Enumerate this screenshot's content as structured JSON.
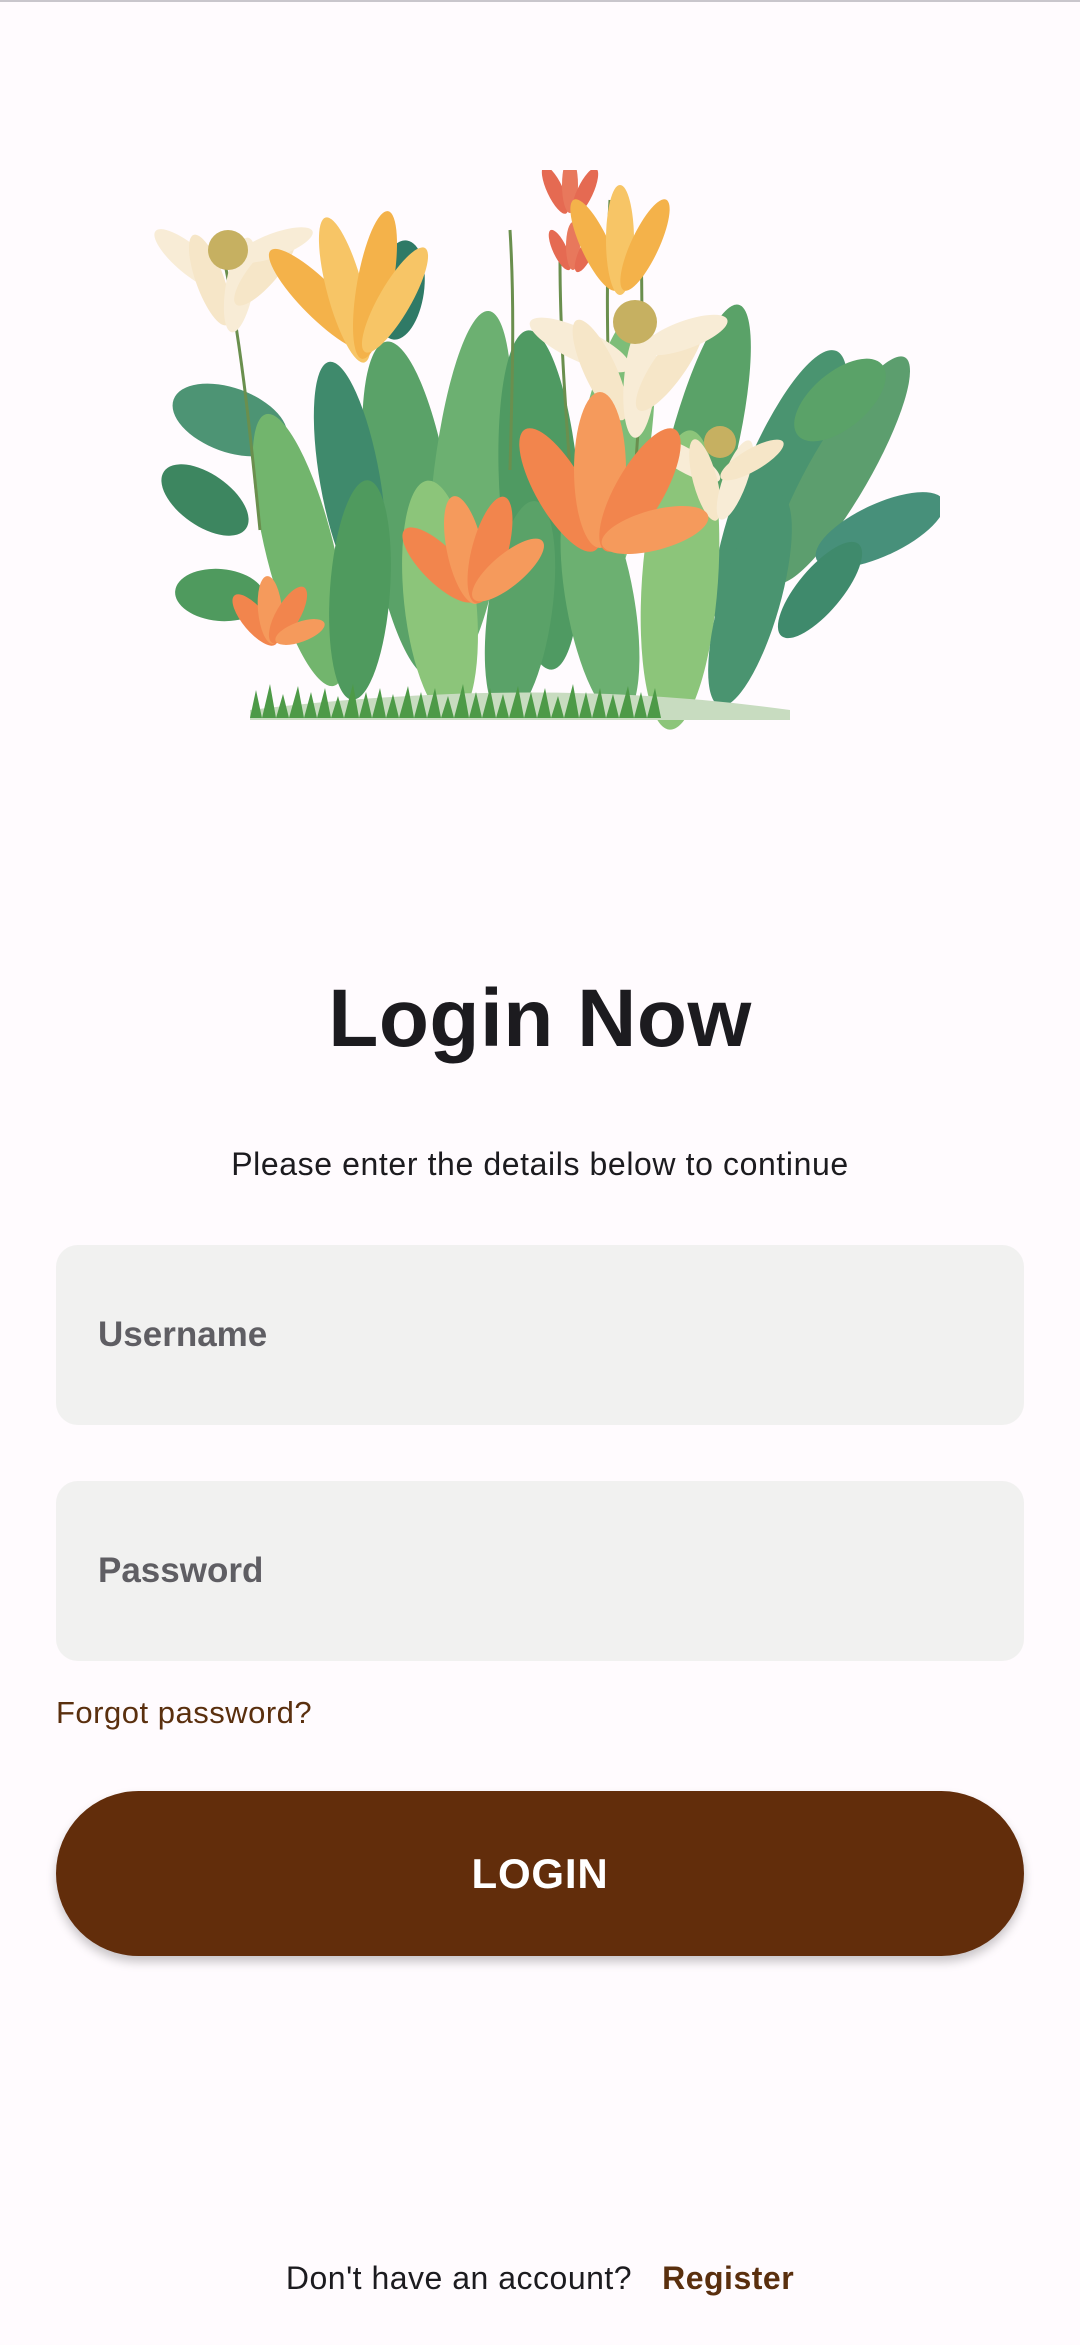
{
  "illustration": {
    "name": "flower-garden-illustration",
    "colors": {
      "leaf_dark": "#3f8a6c",
      "leaf_mid": "#5aa268",
      "leaf_light": "#8cc57a",
      "flower_orange": "#f2854d",
      "flower_yellow": "#f4b24a",
      "flower_white": "#f8ecd6",
      "flower_red": "#e56a52",
      "grass": "#4d9a47"
    }
  },
  "login": {
    "title": "Login Now",
    "subtitle": "Please enter the details below to continue",
    "username": {
      "placeholder": "Username",
      "value": ""
    },
    "password": {
      "placeholder": "Password",
      "value": ""
    },
    "forgot_password": "Forgot password?",
    "button_label": "LOGIN"
  },
  "footer": {
    "prompt": "Don't have an account?",
    "register_link": "Register"
  },
  "colors": {
    "background": "#fffbfe",
    "accent": "#622d0b",
    "link": "#5a2f0e",
    "field_bg": "#f1f1f0"
  }
}
